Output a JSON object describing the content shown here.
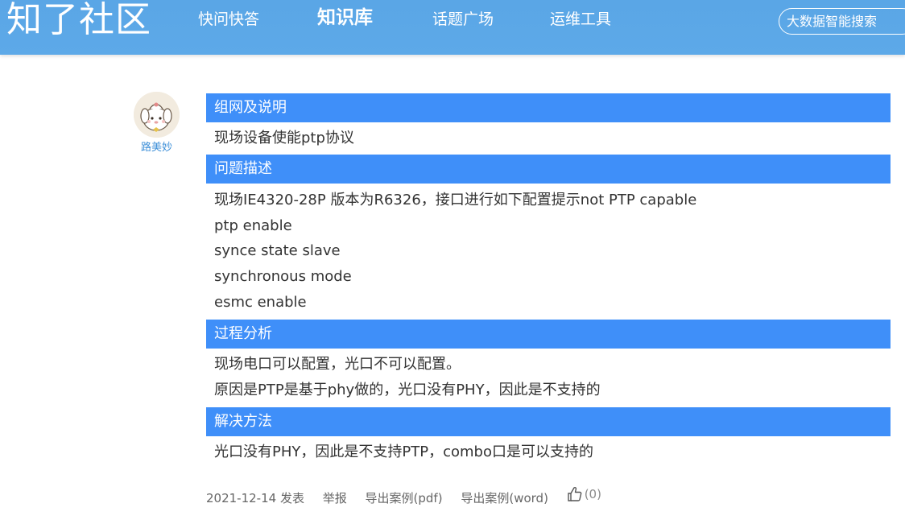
{
  "header": {
    "logo": "知了社区",
    "nav": [
      "快问快答",
      "知识库",
      "话题广场",
      "运维工具"
    ],
    "search_placeholder": "大数据智能搜索"
  },
  "author": {
    "name": "路美妙"
  },
  "sections": [
    {
      "title": "组网及说明",
      "lines": [
        "现场设备使能ptp协议"
      ]
    },
    {
      "title": "问题描述",
      "lines": [
        "现场IE4320-28P 版本为R6326，接口进行如下配置提示not PTP capable",
        "ptp enable",
        "synce state slave",
        "synchronous mode",
        "esmc enable"
      ]
    },
    {
      "title": "过程分析",
      "lines": [
        "现场电口可以配置，光口不可以配置。",
        "原因是PTP是基于phy做的，光口没有PHY，因此是不支持的"
      ]
    },
    {
      "title": "解决方法",
      "lines": [
        "光口没有PHY，因此是不支持PTP，combo口是可以支持的"
      ]
    }
  ],
  "footer": {
    "date": "2021-12-14 发表",
    "report": "举报",
    "export_pdf": "导出案例(pdf)",
    "export_word": "导出案例(word)",
    "likes": "(0)"
  },
  "colors": {
    "header": "#5aa6e6",
    "section_bar": "#3f8ff9",
    "author_link": "#3d8fd8"
  }
}
